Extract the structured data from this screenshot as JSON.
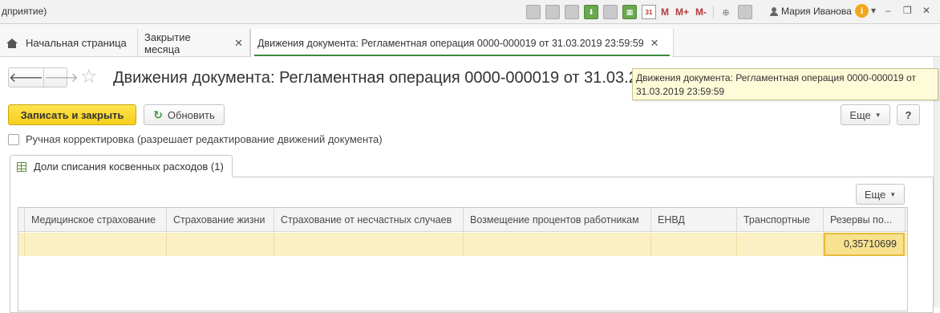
{
  "titlebar": {
    "app_title": "дприятие)",
    "user_name": "Мария Иванова",
    "m_labels": [
      "M",
      "M+",
      "M-"
    ],
    "calendar_day": "31"
  },
  "tabs": [
    {
      "label": "Начальная страница",
      "icon": "home-icon",
      "closable": false
    },
    {
      "label": "Закрытие месяца",
      "closable": true
    },
    {
      "label": "Движения документа: Регламентная операция 0000-000019 от 31.03.2019 23:59:59",
      "closable": true,
      "active": true
    }
  ],
  "tab_close_glyph": "✕",
  "form": {
    "title": "Движения документа: Регламентная операция 0000-000019 от 31.03.2019 23:59:59",
    "tooltip": "Движения документа: Регламентная операция 0000-000019 от 31.03.2019 23:59:59",
    "save_close_label": "Записать и закрыть",
    "refresh_label": "Обновить",
    "more_label": "Еще",
    "help_label": "?",
    "manual_edit_label": "Ручная корректировка (разрешает редактирование движений документа)",
    "page_tab_label": "Доли списания косвенных расходов (1)",
    "table_more_label": "Еще"
  },
  "table": {
    "columns": [
      "Медицинское страхование",
      "Страхование жизни",
      "Страхование от несчастных случаев",
      "Возмещение процентов работникам",
      "ЕНВД",
      "Транспортные",
      "Резервы по..."
    ],
    "rows": [
      [
        "",
        "",
        "",
        "",
        "",
        "",
        "0,35710699"
      ]
    ]
  },
  "colors": {
    "primary_button": "#f5cf1c",
    "active_tab_underline": "#3b8b3b",
    "selected_row": "#fbf0c3",
    "selected_cell": "#f8e18f",
    "tooltip_bg": "#fefbd9"
  }
}
